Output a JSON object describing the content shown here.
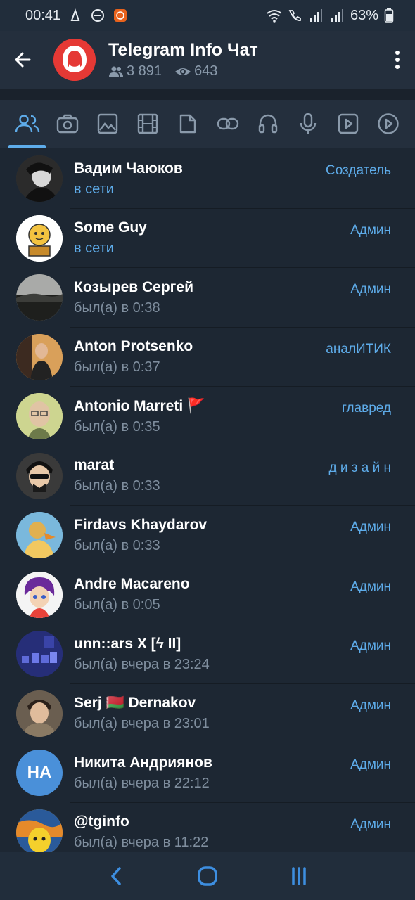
{
  "status_bar": {
    "time": "00:41",
    "battery": "63%"
  },
  "header": {
    "title": "Telegram Info Чат",
    "members": "3 891",
    "online": "643"
  },
  "tabs": [
    {
      "icon": "members-icon",
      "active": true
    },
    {
      "icon": "camera-icon"
    },
    {
      "icon": "image-icon"
    },
    {
      "icon": "video-icon"
    },
    {
      "icon": "file-icon"
    },
    {
      "icon": "link-icon"
    },
    {
      "icon": "headphones-icon"
    },
    {
      "icon": "microphone-icon"
    },
    {
      "icon": "video-message-icon"
    },
    {
      "icon": "gif-icon"
    }
  ],
  "members": [
    {
      "name": "Вадим Чаюков",
      "status": "в сети",
      "online": true,
      "role": "Создатель",
      "avatar_color": "#3a3a3a"
    },
    {
      "name": "Some Guy",
      "status": "в сети",
      "online": true,
      "role": "Админ",
      "avatar_color": "#ffffff"
    },
    {
      "name": "Козырев Сергей",
      "status": "был(а) в 0:38",
      "online": false,
      "role": "Админ",
      "avatar_color": "#4a4f4a"
    },
    {
      "name": "Anton Protsenko",
      "status": "был(а) в 0:37",
      "online": false,
      "role": "аналИТИК",
      "avatar_color": "#c98a4a"
    },
    {
      "name": "Antonio Marreti 🚩",
      "status": "был(а) в 0:35",
      "online": false,
      "role": "главред",
      "avatar_color": "#c8cf8e"
    },
    {
      "name": "marat",
      "status": "был(а) в 0:33",
      "online": false,
      "role": "д и з а й н",
      "avatar_color": "#2c2c2c"
    },
    {
      "name": "Firdavs Khaydarov",
      "status": "был(а) в 0:33",
      "online": false,
      "role": "Админ",
      "avatar_color": "#6fb0d8"
    },
    {
      "name": "Andre Macareno",
      "status": "был(а) в 0:05",
      "online": false,
      "role": "Админ",
      "avatar_color": "#f2f2f2"
    },
    {
      "name": "unn::ars X [ϟ II]",
      "status": "был(а) вчера в 23:24",
      "online": false,
      "role": "Админ",
      "avatar_color": "#26307a"
    },
    {
      "name": "Serj 🇧🇾 Dernakov",
      "status": "был(а) вчера в 23:01",
      "online": false,
      "role": "Админ",
      "avatar_color": "#5a5046"
    },
    {
      "name": "Никита Андриянов",
      "status": "был(а) вчера в 22:12",
      "online": false,
      "role": "Админ",
      "avatar_color": "#4a90d9",
      "initials": "НА"
    },
    {
      "name": "@tginfo",
      "status": "был(а) вчера в 11:22",
      "online": false,
      "role": "Админ",
      "avatar_color": "#d8a83a"
    }
  ]
}
